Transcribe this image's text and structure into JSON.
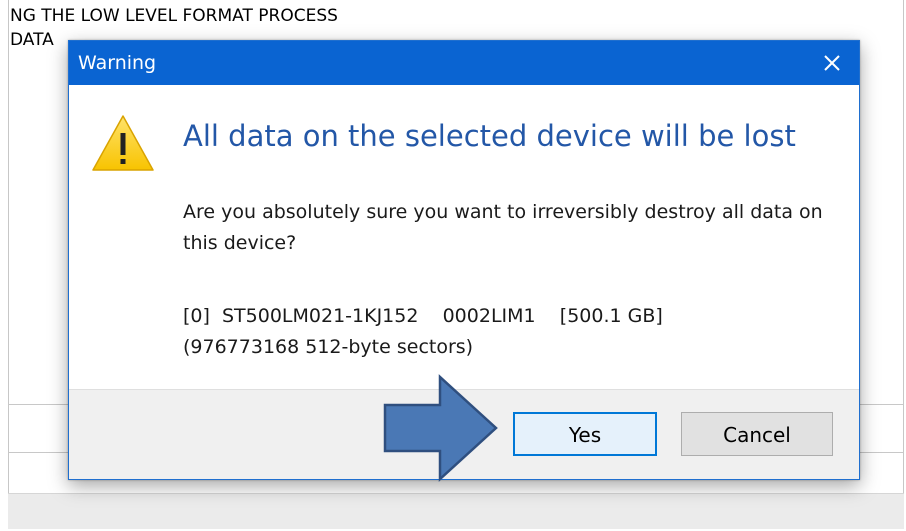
{
  "background": {
    "heading": "NG THE LOW LEVEL FORMAT PROCESS",
    "subtext": "DATA"
  },
  "dialog": {
    "title": "Warning",
    "main_instruction": "All data on the selected device will be lost",
    "body": "Are you absolutely sure you want to irreversibly destroy all data on this device?",
    "device_line1": "[0]  ST500LM021-1KJ152    0002LIM1    [500.1 GB]",
    "device_line2": "(976773168 512-byte sectors)",
    "buttons": {
      "yes": "Yes",
      "cancel": "Cancel"
    },
    "icons": {
      "warning": "warning-triangle-icon",
      "close": "close-icon"
    }
  },
  "colors": {
    "titlebar": "#0a64d2",
    "instruction": "#2357a7",
    "arrow_fill": "#4a78b5",
    "arrow_stroke": "#2f4f7f",
    "warning_fill": "#fcd116"
  }
}
